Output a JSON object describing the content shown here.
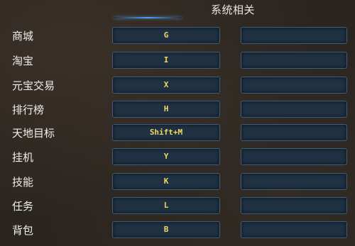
{
  "section_title": "系统相关",
  "rows": [
    {
      "label": "商城",
      "primary": "G",
      "secondary": ""
    },
    {
      "label": "淘宝",
      "primary": "I",
      "secondary": ""
    },
    {
      "label": "元宝交易",
      "primary": "X",
      "secondary": ""
    },
    {
      "label": "排行榜",
      "primary": "H",
      "secondary": ""
    },
    {
      "label": "天地目标",
      "primary": "Shift+M",
      "secondary": ""
    },
    {
      "label": "挂机",
      "primary": "Y",
      "secondary": ""
    },
    {
      "label": "技能",
      "primary": "K",
      "secondary": ""
    },
    {
      "label": "任务",
      "primary": "L",
      "secondary": ""
    },
    {
      "label": "背包",
      "primary": "B",
      "secondary": ""
    }
  ],
  "colors": {
    "key_text": "#f0d860",
    "key_bg": "#1f3143",
    "key_border": "#3f5d78",
    "accent_line": "#4aa3ff"
  }
}
